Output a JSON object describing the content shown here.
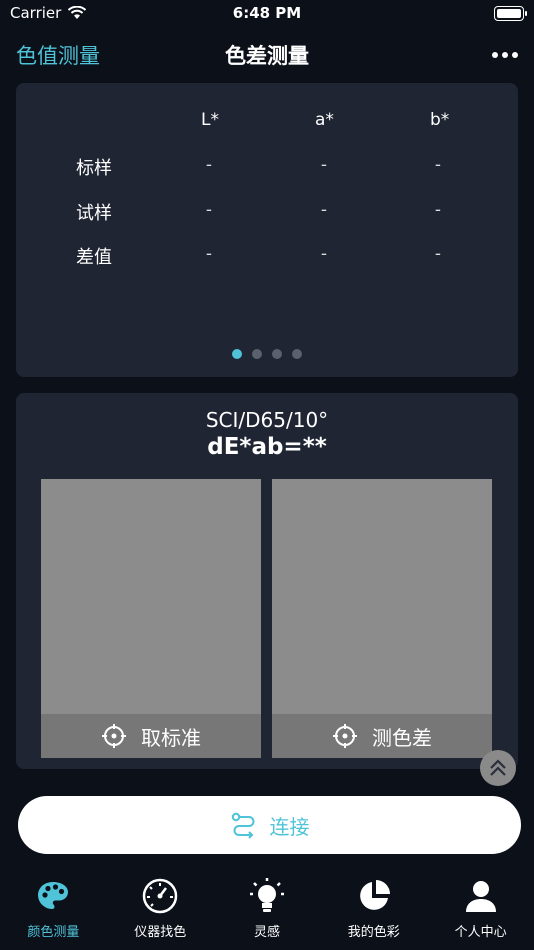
{
  "status_bar": {
    "carrier": "Carrier",
    "time": "6:48 PM"
  },
  "nav": {
    "left_link": "色值测量",
    "title": "色差测量"
  },
  "lab_table": {
    "headers": [
      "L*",
      "a*",
      "b*"
    ],
    "rows": [
      {
        "label": "标样",
        "values": [
          "-",
          "-",
          "-"
        ]
      },
      {
        "label": "试样",
        "values": [
          "-",
          "-",
          "-"
        ]
      },
      {
        "label": "差值",
        "values": [
          "-",
          "-",
          "-"
        ]
      }
    ],
    "page_count": 4,
    "active_page": 1
  },
  "measure": {
    "condition": "SCI/D65/10°",
    "delta_e": "dE*ab=**",
    "standard_button": "取标准",
    "sample_button": "测色差",
    "standard_color": "#8c8c8c",
    "sample_color": "#8c8c8c"
  },
  "connect_button": {
    "label": "连接",
    "icon": "route-icon"
  },
  "tabs": [
    {
      "label": "颜色测量",
      "icon": "palette-icon",
      "active": true
    },
    {
      "label": "仪器找色",
      "icon": "gauge-icon",
      "active": false
    },
    {
      "label": "灵感",
      "icon": "lightbulb-icon",
      "active": false
    },
    {
      "label": "我的色彩",
      "icon": "pie-chart-icon",
      "active": false
    },
    {
      "label": "个人中心",
      "icon": "user-icon",
      "active": false
    }
  ],
  "colors": {
    "accent": "#4fc3d8",
    "background": "#0b1019",
    "card": "#202533"
  }
}
